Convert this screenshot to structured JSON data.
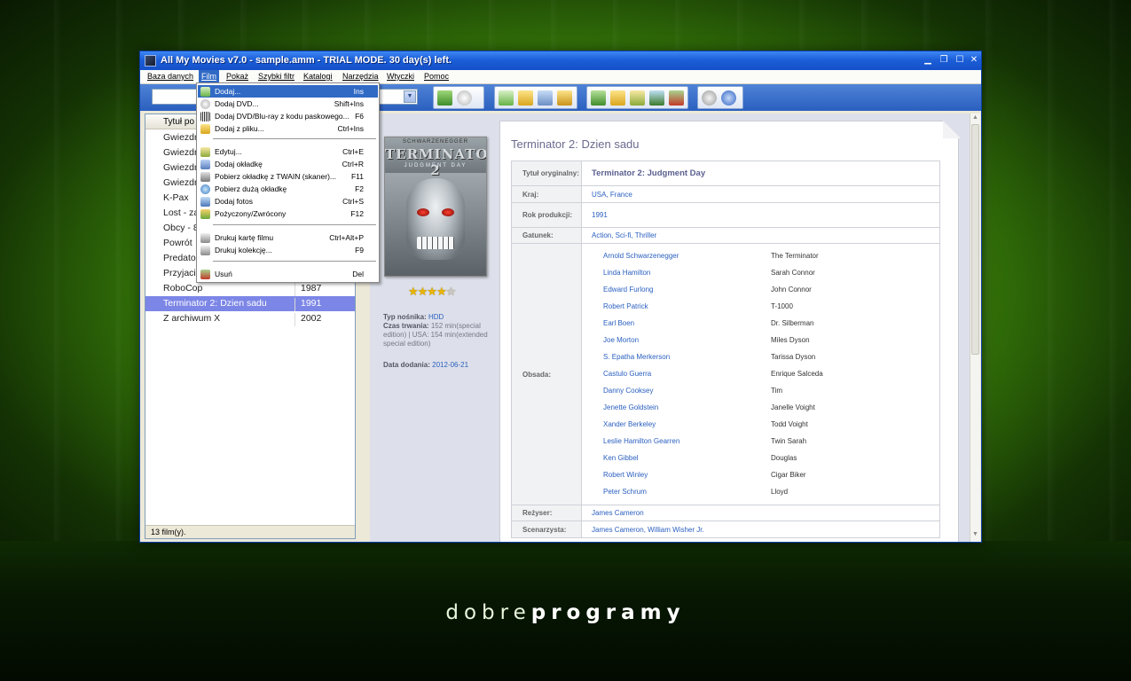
{
  "window": {
    "title": "All My Movies v7.0 - sample.amm - TRIAL MODE. 30 day(s) left.",
    "min_label": "▁",
    "restore_label": "❐",
    "max_label": "☐",
    "close_label": "✕"
  },
  "menubar": [
    {
      "label": "Baza danych"
    },
    {
      "label": "Film"
    },
    {
      "label": "Pokaż"
    },
    {
      "label": "Szybki filtr"
    },
    {
      "label": "Katalogi"
    },
    {
      "label": "Narzędzia"
    },
    {
      "label": "Wtyczki"
    },
    {
      "label": "Pomoc"
    }
  ],
  "toolbar": {
    "combo_arrow": "▼",
    "icons": [
      "add-movie-icon",
      "disc-icon",
      "add-icon",
      "folder-icon",
      "search-person-icon",
      "key-icon",
      "add-green-icon",
      "folder-open-icon",
      "edit-icon",
      "web-icon",
      "delete-icon",
      "settings-icon",
      "help-icon"
    ]
  },
  "film_menu": [
    {
      "label": "Dodaj...",
      "shortcut": "Ins",
      "icon": "add-icon",
      "highlighted": true
    },
    {
      "label": "Dodaj DVD...",
      "shortcut": "Shift+Ins",
      "icon": "dvd-icon"
    },
    {
      "label": "Dodaj DVD/Blu-ray z kodu paskowego...",
      "shortcut": "F6",
      "icon": "barcode-icon"
    },
    {
      "label": "Dodaj z pliku...",
      "shortcut": "Ctrl+Ins",
      "icon": "file-icon"
    },
    {
      "label": "Edytuj...",
      "shortcut": "Ctrl+E",
      "icon": "edit-icon"
    },
    {
      "label": "Dodaj okładkę",
      "shortcut": "Ctrl+R",
      "icon": "cover-icon"
    },
    {
      "label": "Pobierz okładkę z TWAIN (skaner)...",
      "shortcut": "F11",
      "icon": "scanner-icon"
    },
    {
      "label": "Pobierz dużą okładkę",
      "shortcut": "F2",
      "icon": "web-cover-icon"
    },
    {
      "label": "Dodaj fotos",
      "shortcut": "Ctrl+S",
      "icon": "photo-icon"
    },
    {
      "label": "Pożyczony/Zwrócony",
      "shortcut": "F12",
      "icon": "loan-icon"
    },
    {
      "label": "Drukuj kartę filmu",
      "shortcut": "Ctrl+Alt+P",
      "icon": "print-icon"
    },
    {
      "label": "Drukuj kolekcję...",
      "shortcut": "F9",
      "icon": "print-collection-icon"
    },
    {
      "label": "Usuń",
      "shortcut": "Del",
      "icon": "delete-icon"
    }
  ],
  "movie_list": {
    "header": "Tytuł po",
    "rows": [
      {
        "title": "Gwiezdn",
        "year": ""
      },
      {
        "title": "Gwiezdn",
        "year": ""
      },
      {
        "title": "Gwiezdn",
        "year": ""
      },
      {
        "title": "Gwiezdn",
        "year": ""
      },
      {
        "title": "K-Pax",
        "year": ""
      },
      {
        "title": "Lost - za",
        "year": ""
      },
      {
        "title": "Obcy - 8",
        "year": ""
      },
      {
        "title": "Powrót",
        "year": ""
      },
      {
        "title": "Predato",
        "year": ""
      },
      {
        "title": "Przyjaci",
        "year": ""
      },
      {
        "title": "RoboCop",
        "year": "1987"
      },
      {
        "title": "Terminator 2: Dzien sadu",
        "year": "1991",
        "selected": true
      },
      {
        "title": "Z archiwum X",
        "year": "2002"
      }
    ],
    "status": "13 film(y)."
  },
  "cover": {
    "name": "SCHWARZENEGGER",
    "title": "TERMINATOR 2",
    "subtitle": "JUDGMENT DAY"
  },
  "rating": {
    "stars": "★★★★",
    "off_star": "★",
    "value": 4.5,
    "max": 5
  },
  "meta": {
    "media_label": "Typ nośnika:",
    "media_value": "HDD",
    "duration_label": "Czas trwania:",
    "duration_value": "152 min(special edition) | USA: 154 min(extended special edition)",
    "added_label": "Data dodania:",
    "added_value": "2012-06-21"
  },
  "detail": {
    "title": "Terminator 2: Dzien sadu",
    "original_title_label": "Tytuł oryginalny:",
    "original_title": "Terminator 2: Judgment Day",
    "country_label": "Kraj:",
    "country": "USA, France",
    "year_label": "Rok produkcji:",
    "year": "1991",
    "genre_label": "Gatunek:",
    "genre": "Action, Sci-fi, Thriller",
    "cast_label": "Obsada:",
    "cast": [
      {
        "actor": "Arnold Schwarzenegger",
        "role": "The Terminator"
      },
      {
        "actor": "Linda Hamilton",
        "role": "Sarah Connor"
      },
      {
        "actor": "Edward Furlong",
        "role": "John Connor"
      },
      {
        "actor": "Robert Patrick",
        "role": "T-1000"
      },
      {
        "actor": "Earl Boen",
        "role": "Dr. Silberman"
      },
      {
        "actor": "Joe Morton",
        "role": "Miles Dyson"
      },
      {
        "actor": "S. Epatha Merkerson",
        "role": "Tarissa Dyson"
      },
      {
        "actor": "Castulo Guerra",
        "role": "Enrique Salceda"
      },
      {
        "actor": "Danny Cooksey",
        "role": "Tim"
      },
      {
        "actor": "Jenette Goldstein",
        "role": "Janelle Voight"
      },
      {
        "actor": "Xander Berkeley",
        "role": "Todd Voight"
      },
      {
        "actor": "Leslie Hamilton Gearren",
        "role": "Twin Sarah"
      },
      {
        "actor": "Ken Gibbel",
        "role": "Douglas"
      },
      {
        "actor": "Robert Winley",
        "role": "Cigar Biker"
      },
      {
        "actor": "Peter Schrum",
        "role": "Lloyd"
      }
    ],
    "director_label": "Reżyser:",
    "director": "James Cameron",
    "writer_label": "Scenarzysta:",
    "writer": "James Cameron, William Wisher Jr."
  },
  "scroll": {
    "up": "▲",
    "down": "▼"
  },
  "brand": {
    "part1": "dobre",
    "part2": "programy"
  },
  "colors": {
    "accent": "#316ac5",
    "title_bar": "#1c5fd8",
    "selection": "#7c86e6",
    "link": "#2a5fbf"
  }
}
